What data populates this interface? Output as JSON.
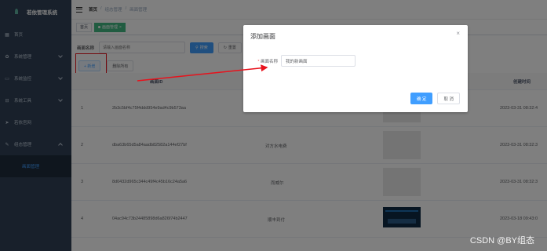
{
  "app": {
    "title": "若依管理系统"
  },
  "sidebar": {
    "items": [
      {
        "label": "首页",
        "icon": "dashboard-icon"
      },
      {
        "label": "系统管理",
        "icon": "gear-icon"
      },
      {
        "label": "系统监控",
        "icon": "monitor-icon"
      },
      {
        "label": "系统工具",
        "icon": "tool-icon"
      },
      {
        "label": "若依官网",
        "icon": "send-icon"
      },
      {
        "label": "组态管理",
        "icon": "edit-icon"
      }
    ],
    "sub_items": [
      {
        "label": "画面管理"
      }
    ]
  },
  "header": {
    "breadcrumb": [
      "首页",
      "组态管理",
      "画面管理"
    ]
  },
  "tags": [
    {
      "label": "首页",
      "active": false
    },
    {
      "label": "画面管理",
      "active": true,
      "close": "×"
    }
  ],
  "search": {
    "label": "画面名称",
    "placeholder": "请输入画面名称",
    "search_button": "搜索",
    "reset_button": "重置"
  },
  "toolbar": {
    "add_button": "+ 新增",
    "delete_button": "删除所有"
  },
  "table": {
    "columns": [
      "画面ID",
      "创建时间"
    ],
    "rows": [
      {
        "index": "1",
        "id": "2b3c5bf4c75f4ddd954e9ad4c9b573aa",
        "name": "",
        "time": "2023-03-31 08:32:4",
        "thumb": "blank"
      },
      {
        "index": "2",
        "id": "dba63b65d5a84aadb82582a144ef27bf",
        "name": "对方水电费",
        "time": "2023-03-31 08:32:3",
        "thumb": "blank"
      },
      {
        "index": "3",
        "id": "8d0432d965c344c49f4c45b16c24a5a6",
        "name": "而威尔",
        "time": "2023-03-31 08:32:3",
        "thumb": "blank"
      },
      {
        "index": "4",
        "id": "04ac94c73b24485898d6a826f74b2447",
        "name": "顺丰到付",
        "time": "2023-03-18 09:43:0",
        "thumb": "screen"
      }
    ]
  },
  "dialog": {
    "title": "添加画面",
    "close": "×",
    "field_label": "画面名称",
    "required_mark": "*",
    "field_value": "我的新画面",
    "confirm": "确 定",
    "cancel": "取 消"
  },
  "watermark": "CSDN @BY组态",
  "colors": {
    "sidebar": "#304156",
    "primary": "#409eff",
    "tag_active": "#42b983",
    "annotation": "#e8121c"
  }
}
